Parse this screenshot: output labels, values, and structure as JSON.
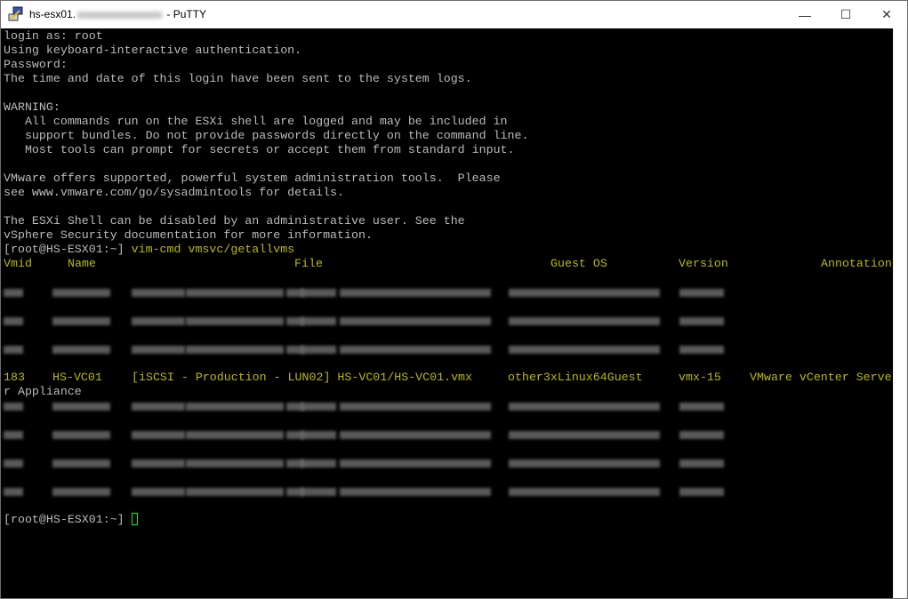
{
  "window": {
    "title_prefix": "hs-esx01.",
    "title_suffix": " - PuTTY",
    "minimize": "—",
    "maximize": "☐",
    "close": "✕"
  },
  "terminal": {
    "lines": [
      "login as: root",
      "Using keyboard-interactive authentication.",
      "Password:",
      "The time and date of this login have been sent to the system logs.",
      "",
      "WARNING:",
      "   All commands run on the ESXi shell are logged and may be included in",
      "   support bundles. Do not provide passwords directly on the command line.",
      "   Most tools can prompt for secrets or accept them from standard input.",
      "",
      "VMware offers supported, powerful system administration tools.  Please",
      "see www.vmware.com/go/sysadmintools for details.",
      "",
      "The ESXi Shell can be disabled by an administrative user. See the",
      "vSphere Security documentation for more information."
    ],
    "prompt": "[root@HS-ESX01:~]",
    "command": "vim-cmd vmsvc/getallvms",
    "headers": {
      "vmid": "Vmid",
      "name": "Name",
      "file": "File",
      "guest_os": "Guest OS",
      "version": "Version",
      "annotation": "Annotation"
    },
    "visible_vm": {
      "vmid": "183",
      "name": "HS-VC01",
      "file": "[iSCSI - Production - LUN02] HS-VC01/HS-VC01.vmx",
      "guest_os": "other3xLinux64Guest",
      "version": "vmx-15",
      "annotation": "VMware vCenter Serve",
      "annotation_wrap": "r Appliance"
    },
    "final_prompt": "[root@HS-ESX01:~]"
  },
  "colors": {
    "text": "#bbbbbb",
    "yellow": "#bbbb00",
    "cursor": "#00ff00",
    "background": "#000000"
  }
}
